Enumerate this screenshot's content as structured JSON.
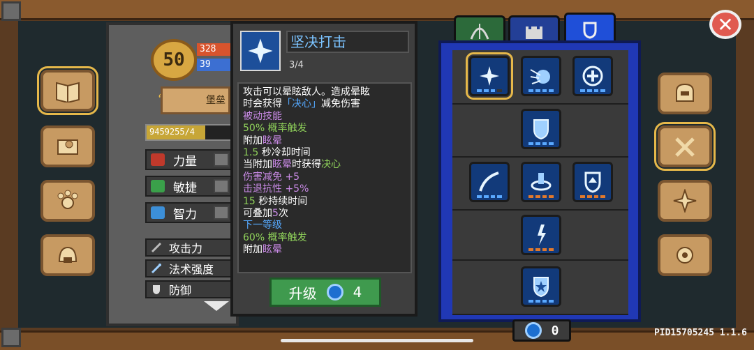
{
  "player": {
    "level": "50",
    "hp": "328",
    "mp": "39",
    "title": "堡垒",
    "xp_text": "9459255/4",
    "xp_progress": 0.7
  },
  "attributes": [
    {
      "label": "力量",
      "icon": "fist-icon",
      "color": "#c0392b"
    },
    {
      "label": "敏捷",
      "icon": "feather-icon",
      "color": "#3aa04a"
    },
    {
      "label": "智力",
      "icon": "book-icon",
      "color": "#3c8fd8"
    }
  ],
  "stats": [
    {
      "label": "攻击力",
      "icon": "sword-icon"
    },
    {
      "label": "法术强度",
      "icon": "wand-icon"
    },
    {
      "label": "防御",
      "icon": "shield-icon"
    }
  ],
  "tooltip": {
    "title": "坚决打击",
    "level": "3/4",
    "lines": [
      [
        {
          "t": "攻击可以晕眩敌人。造成晕眩",
          "c": "white"
        }
      ],
      [
        {
          "t": "时会获得",
          "c": "white"
        },
        {
          "t": "「决心」",
          "c": "blue"
        },
        {
          "t": "减免伤害",
          "c": "white"
        }
      ],
      [
        {
          "t": "被动技能",
          "c": "purple"
        }
      ],
      [
        {
          "t": "50%",
          "c": "green"
        },
        {
          "t": " 概率触发",
          "c": "green"
        }
      ],
      [
        {
          "t": "附加",
          "c": "white"
        },
        {
          "t": "眩晕",
          "c": "purple"
        }
      ],
      [
        {
          "t": "1.5",
          "c": "green"
        },
        {
          "t": " 秒冷却时间",
          "c": "white"
        }
      ],
      [
        {
          "t": "当附加",
          "c": "white"
        },
        {
          "t": "眩晕",
          "c": "purple"
        },
        {
          "t": "时获得",
          "c": "white"
        },
        {
          "t": "决心",
          "c": "green"
        }
      ],
      [
        {
          "t": "伤害减免 +5",
          "c": "purple"
        }
      ],
      [
        {
          "t": "击退抗性 +5%",
          "c": "purple"
        }
      ],
      [
        {
          "t": "15",
          "c": "green"
        },
        {
          "t": " 秒持续时间",
          "c": "white"
        }
      ],
      [
        {
          "t": "可叠加",
          "c": "white"
        },
        {
          "t": "5",
          "c": "purple"
        },
        {
          "t": "次",
          "c": "white"
        }
      ],
      [
        {
          "t": " ",
          "c": "white"
        }
      ],
      [
        {
          "t": "下一等级",
          "c": "blue"
        }
      ],
      [
        {
          "t": "60%",
          "c": "green"
        },
        {
          "t": " 概率触发",
          "c": "green"
        }
      ],
      [
        {
          "t": "附加",
          "c": "white"
        },
        {
          "t": "眩晕",
          "c": "purple"
        }
      ]
    ],
    "upgrade_label": "升级",
    "upgrade_cost": "4"
  },
  "tabs": [
    {
      "icon": "bow-icon",
      "color": "#2c6a3a"
    },
    {
      "icon": "castle-icon",
      "color": "#233f96"
    },
    {
      "icon": "shield-tab-icon",
      "color": "#1f4fd8",
      "active": true
    }
  ],
  "gems": "0",
  "pid": "PID15705245 1.1.6"
}
